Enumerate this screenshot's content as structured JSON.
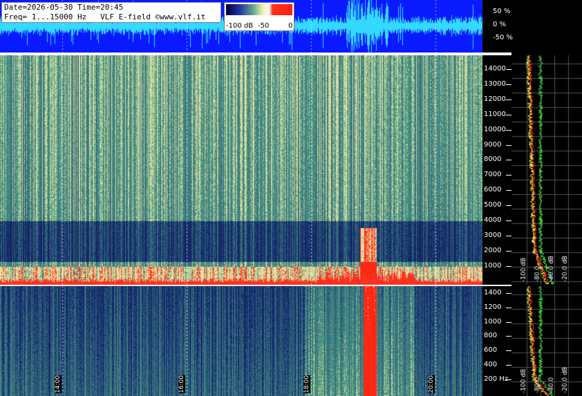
{
  "info": {
    "line1": "Date=2026-05-30 Time=20:45",
    "line2": "Freq= 1...15000 Hz   VLF E-field ©www.vlf.it"
  },
  "scale": {
    "min_label": "-100 dB",
    "mid_label": "-50",
    "max_label": "0"
  },
  "waveform_axis": {
    "labels": [
      "50 %",
      "0 %",
      "-50 %"
    ]
  },
  "freq_axis_upper": [
    "14000",
    "13000",
    "12000",
    "11000",
    "10000",
    "9000",
    "8000",
    "7000",
    "6000",
    "5000",
    "4000",
    "3000",
    "2000",
    "1000"
  ],
  "freq_axis_lower": [
    "1400",
    "1200",
    "1000",
    "800",
    "600",
    "400",
    "200 Hz"
  ],
  "profile_labels_upper": [
    "-100 dB",
    "-80.0",
    "-40.0 dB",
    "-20.0 dB"
  ],
  "profile_labels_lower": [
    "-100 dB",
    "-80.0",
    "-40.0",
    "-20.0 dB"
  ],
  "time_labels": [
    "14:00",
    "16:00",
    "18:00",
    "20:00"
  ],
  "colors": {
    "waveform_bg": "#0a1aff",
    "waveform_fg": "#33d9ff",
    "spectrum_dark": "#1c2d6b",
    "spectrum_mid": "#5f9a8c",
    "spectrum_hot": "#ff2a10",
    "profile_red": "#ff3020",
    "profile_yellow": "#ffff40",
    "profile_green": "#40ff40"
  }
}
